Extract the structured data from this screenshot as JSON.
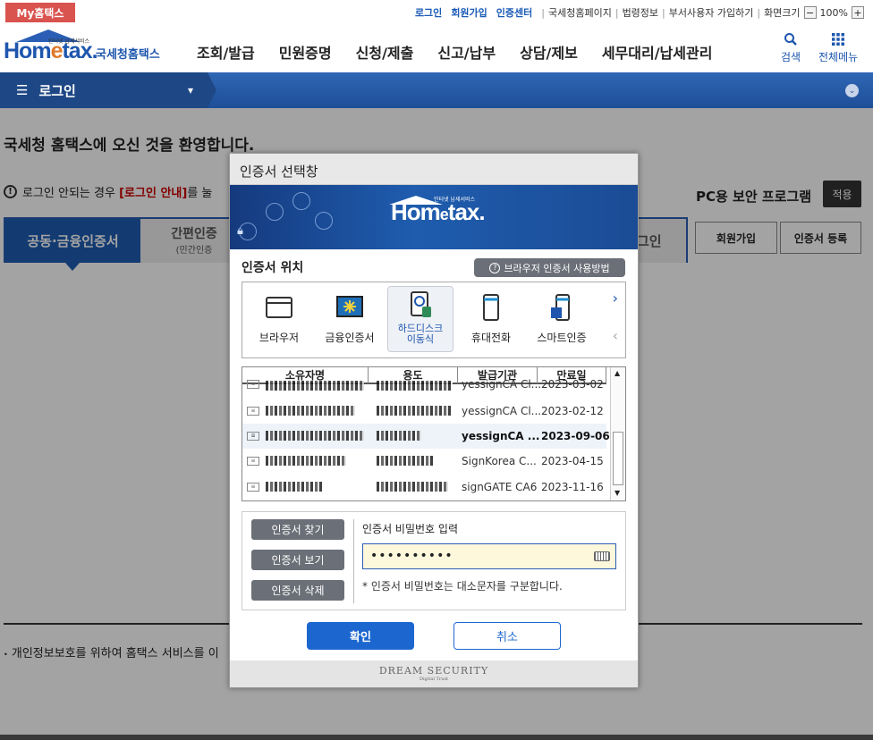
{
  "header": {
    "my_badge": "My홈택스",
    "top_links": [
      "로그인",
      "회원가입",
      "인증센터"
    ],
    "sub_links": [
      "국세청홈페이지",
      "법령정보",
      "부서사용자 가입하기",
      "화면크기"
    ],
    "zoom_minus": "−",
    "zoom_level": "100%",
    "zoom_plus": "+",
    "logo_word_a": "Hom",
    "logo_word_e": "e",
    "logo_word_b": "tax.",
    "logo_tagline": "인터넷 납세서비스",
    "logo_korean": "국세청홈택스",
    "nav": [
      "조회/발급",
      "민원증명",
      "신청/제출",
      "신고/납부",
      "상담/제보",
      "세무대리/납세관리"
    ],
    "search_label": "검색",
    "all_menu_label": "전체메뉴"
  },
  "login_bar": {
    "menu_icon": "hamburger-icon",
    "title": "로그인",
    "dropdown": "▾",
    "right": "⌄"
  },
  "page": {
    "welcome": "국세청 홈택스에 오신 것을 환영합니다.",
    "notice_prefix": "로그인 안되는 경우",
    "notice_link": "[로그인 안내]",
    "notice_suffix": "를 눌",
    "pc_security": "PC용 보안 프로그램",
    "apply_btn": "적용",
    "tab_cert": "공동·금융인증서",
    "tab_simple": "간편인증",
    "tab_simple_sub": "(민간인증",
    "tab_login": "그인",
    "join_btn": "회원가입",
    "cert_register_btn": "인증서 등록",
    "privacy_note": "개인정보보호를 위하여 홈택스 서비스를 이"
  },
  "dialog": {
    "title": "인증서 선택창",
    "banner_word_a": "Hom",
    "banner_word_e": "e",
    "banner_word_b": "tax.",
    "banner_tagline": "인터넷 납세서비스",
    "location_title": "인증서 위치",
    "how_to_btn": "브라우저 인증서 사용방법",
    "locations": [
      {
        "label": "브라우저",
        "icon": "browser-icon"
      },
      {
        "label": "금융인증서",
        "icon": "financial-cert-icon"
      },
      {
        "label": "하드디스크\n이동식",
        "icon": "harddisk-icon",
        "selected": true
      },
      {
        "label": "휴대전화",
        "icon": "mobile-phone-icon"
      },
      {
        "label": "스마트인증",
        "icon": "smart-cert-icon"
      }
    ],
    "next_arrow": "›",
    "prev_arrow": "‹",
    "columns": [
      "소유자명",
      "용도",
      "발급기관",
      "만료일"
    ],
    "rows": [
      {
        "issuer": "yessignCA Cl...",
        "expiry": "2023-03-02"
      },
      {
        "issuer": "yessignCA Cl...",
        "expiry": "2023-02-12"
      },
      {
        "issuer": "yessignCA ...",
        "expiry": "2023-09-06",
        "selected": true
      },
      {
        "issuer": "SignKorea C...",
        "expiry": "2023-04-15"
      },
      {
        "issuer": "signGATE CA6",
        "expiry": "2023-11-16"
      }
    ],
    "row_partial_prefix_5": "...",
    "find_btn": "인증서 찾기",
    "view_btn": "인증서 보기",
    "delete_btn": "인증서 삭제",
    "pw_label": "인증서 비밀번호 입력",
    "pw_value": "••••••••••",
    "pw_note": "* 인증서 비밀번호는 대소문자를 구분합니다.",
    "ok_btn": "확인",
    "cancel_btn": "취소",
    "footer_brand": "DREAM SECURITY",
    "footer_tag": "Digital Trust"
  }
}
